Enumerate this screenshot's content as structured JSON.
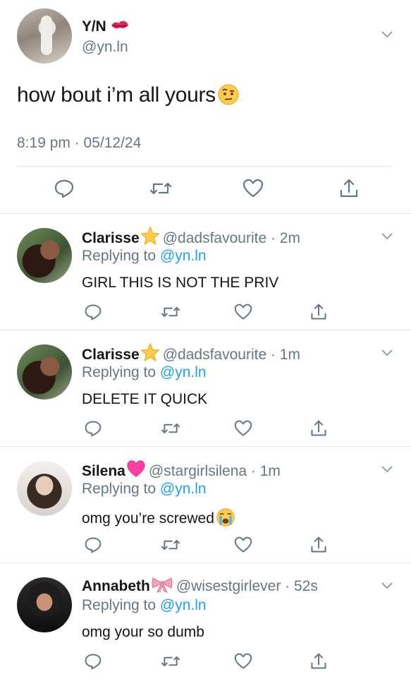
{
  "tweet": {
    "name": "Y/N",
    "name_emoji_icon": "kiss-mark-icon",
    "handle": "@yn.ln",
    "text": "how bout i’m all yours",
    "text_emoji_icon": "raised-eyebrow-face-icon",
    "timestamp": "8:19 pm · 05/12/24",
    "actions": [
      "reply-icon",
      "retweet-icon",
      "like-icon",
      "share-icon"
    ]
  },
  "replies": [
    {
      "name": "Clarisse",
      "emoji_icon": "star-icon",
      "handle_time": "@dadsfavourite · 2m",
      "replying_prefix": "Replying to ",
      "mention": "@yn.ln",
      "text": "GIRL THIS IS NOT THE PRIV"
    },
    {
      "name": "Clarisse",
      "emoji_icon": "star-icon",
      "handle_time": "@dadsfavourite · 1m",
      "replying_prefix": "Replying to ",
      "mention": "@yn.ln",
      "text": "DELETE IT QUICK"
    },
    {
      "name": "Silena",
      "emoji_icon": "pink-heart-icon",
      "handle_time": "@stargirlsilena · 1m",
      "replying_prefix": "Replying to ",
      "mention": "@yn.ln",
      "text": "omg you’re screwed",
      "text_emoji_icon": "crying-face-icon"
    },
    {
      "name": "Annabeth",
      "emoji_icon": "ribbon-bow-icon",
      "handle_time": "@wisestgirlever · 52s",
      "replying_prefix": "Replying to ",
      "mention": "@yn.ln",
      "text": "omg your so dumb"
    }
  ],
  "colors": {
    "text": "#14171a",
    "secondary": "#657786",
    "link": "#1da1f2",
    "divider": "#e1e8ed"
  }
}
